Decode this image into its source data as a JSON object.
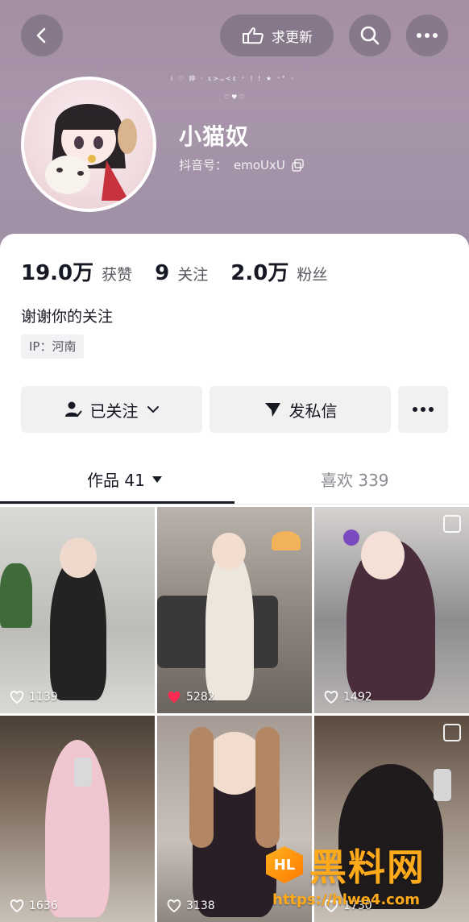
{
  "header": {
    "update_label": "求更新",
    "deco_line1": "i ♡ 婷 · ε>ᴗ<ε ⁺ ! ! ★ ⁺° ◦",
    "deco_line2": "♡♥♡"
  },
  "profile": {
    "nickname": "小猫奴",
    "account_label": "抖音号：",
    "account_id": "emoUxU"
  },
  "stats": {
    "likes_value": "19.0万",
    "likes_label": "获赞",
    "following_value": "9",
    "following_label": "关注",
    "followers_value": "2.0万",
    "followers_label": "粉丝"
  },
  "bio": "谢谢你的关注",
  "ip": "IP：河南",
  "actions": {
    "follow_label": "已关注",
    "message_label": "发私信"
  },
  "tabs": {
    "works_label": "作品 41",
    "likes_label": "喜欢 339"
  },
  "videos": [
    {
      "likes": "1139",
      "liked": false,
      "pinned": false
    },
    {
      "likes": "5282",
      "liked": true,
      "pinned": false
    },
    {
      "likes": "1492",
      "liked": false,
      "pinned": true
    },
    {
      "likes": "1636",
      "liked": false,
      "pinned": false
    },
    {
      "likes": "3138",
      "liked": false,
      "pinned": false
    },
    {
      "likes": "1730",
      "liked": false,
      "pinned": true
    }
  ],
  "watermark": {
    "logo": "HL",
    "text": "黑料网",
    "url": "https://hlwe4.com"
  },
  "colors": {
    "header_bg": "#a48ea4",
    "like_active": "#fe2c55",
    "watermark": "#ffaa1a"
  }
}
